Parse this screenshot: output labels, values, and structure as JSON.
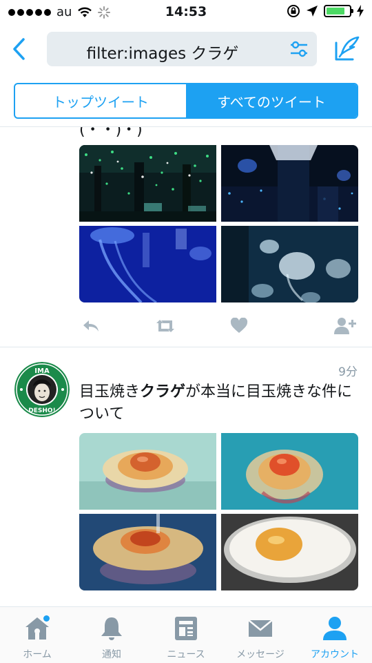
{
  "status_bar": {
    "carrier": "au",
    "time": "14:53",
    "battery_level": 0.8
  },
  "nav": {
    "search_query": "filter:images クラゲ"
  },
  "segments": {
    "top": "トップツイート",
    "all": "すべてのツイート",
    "active": "all"
  },
  "feed": {
    "previous_tweet": {
      "truncated_text": "(・・)・)"
    },
    "tweet": {
      "time": "9分",
      "avatar_text_top": "IMA",
      "avatar_text_bottom": "DESHO!",
      "text_before": "目玉焼き",
      "text_bold": "クラゲ",
      "text_after": "が本当に目玉焼きな件について"
    }
  },
  "tabbar": {
    "home": "ホーム",
    "notifications": "通知",
    "news": "ニュース",
    "messages": "メッセージ",
    "account": "アカウント",
    "active": "account"
  },
  "colors": {
    "accent": "#1da1f2",
    "muted": "#8899a6",
    "battery": "#4cd964"
  },
  "icons": {
    "back": "chevron-left-icon",
    "filter": "sliders-icon",
    "compose": "quill-icon",
    "reply": "reply-icon",
    "retweet": "retweet-icon",
    "like": "heart-icon",
    "follow": "add-user-icon",
    "home": "home-icon",
    "notifications": "bell-icon",
    "news": "news-icon",
    "messages": "envelope-icon",
    "account": "person-icon"
  }
}
